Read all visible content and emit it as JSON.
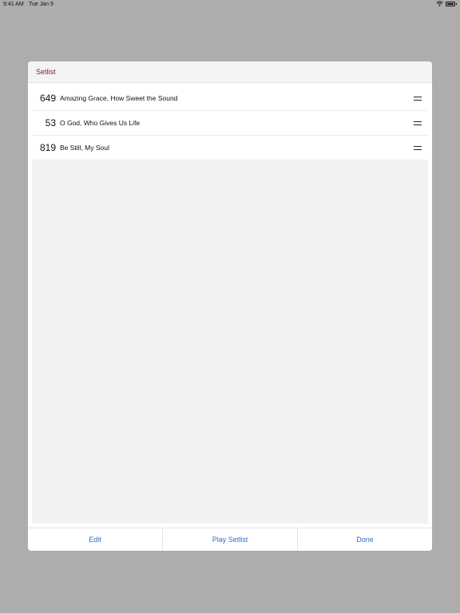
{
  "status_bar": {
    "time": "9:41 AM",
    "date": "Tue Jan 9"
  },
  "modal": {
    "title": "Setlist",
    "items": [
      {
        "number": "649",
        "title": "Amazing Grace, How Sweet the Sound"
      },
      {
        "number": "53",
        "title": "O God, Who Gives Us Life"
      },
      {
        "number": "819",
        "title": "Be Still, My Soul"
      }
    ],
    "footer": {
      "edit": "Edit",
      "play": "Play Setlist",
      "done": "Done"
    }
  },
  "colors": {
    "title": "#7a1a2a",
    "accent": "#2f6bd3",
    "backdrop": "#adadad"
  },
  "icons": [
    "wifi-icon",
    "battery-icon",
    "drag-handle-icon"
  ]
}
